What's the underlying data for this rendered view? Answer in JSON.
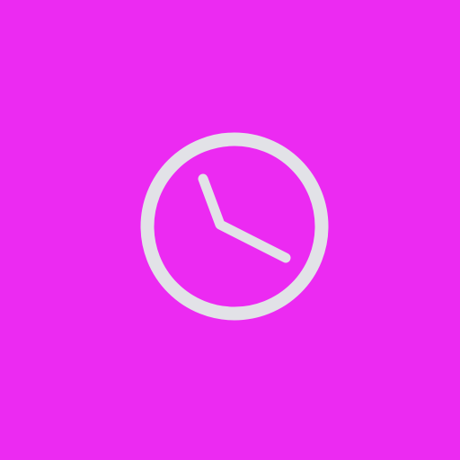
{
  "theme": {
    "background": "#EC2AF2",
    "icon_color": "#E2E2E7"
  },
  "icon": {
    "name": "clock-icon"
  }
}
